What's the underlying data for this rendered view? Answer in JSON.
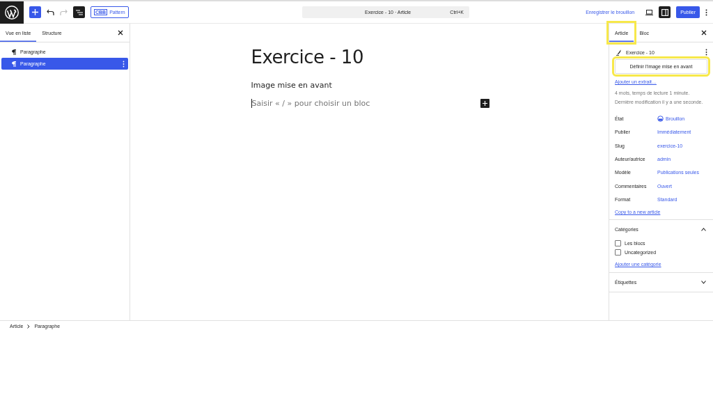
{
  "topbar": {
    "pattern_tag": "CBB",
    "pattern_label": "Pattern",
    "command": "Exercice - 10 · Article",
    "shortcut": "Ctrl+K",
    "save_draft": "Enregistrer le brouillon",
    "settings_open": true,
    "publish": "Publier"
  },
  "list_view": {
    "tabs": [
      {
        "label": "Vue en liste",
        "selected": true
      },
      {
        "label": "Structure",
        "selected": false
      }
    ],
    "items": [
      {
        "label": "Paragraphe",
        "selected": false
      },
      {
        "label": "Paragraphe",
        "selected": true
      }
    ]
  },
  "canvas": {
    "title": "Exercice - 10",
    "paragraph": "Image mise en avant",
    "placeholder": "Saisir « / » pour choisir un bloc"
  },
  "sidebar": {
    "tabs": [
      {
        "label": "Article",
        "selected": true,
        "highlighted": true
      },
      {
        "label": "Bloc",
        "selected": false,
        "highlighted": false
      }
    ],
    "post_title": "Exercice - 10",
    "featured_image_button": {
      "label": "Définir l’image mise en avant",
      "highlighted": true
    },
    "excerpt_link": "Ajouter un extrait…",
    "stats": "4 mots, temps de lecture 1 minute.",
    "last_modified": "Dernière modification il y a une seconde.",
    "fields": [
      {
        "label": "État",
        "value": "Brouillon",
        "kind": "status"
      },
      {
        "label": "Publier",
        "value": "Immédiatement",
        "kind": "link"
      },
      {
        "label": "Slug",
        "value": "exercice-10",
        "kind": "link"
      },
      {
        "label": "Auteur/autrice",
        "value": "admin",
        "kind": "link"
      },
      {
        "label": "Modèle",
        "value": "Publications seules",
        "kind": "link"
      },
      {
        "label": "Commentaires",
        "value": "Ouvert",
        "kind": "link"
      },
      {
        "label": "Format",
        "value": "Standard",
        "kind": "link"
      }
    ],
    "copy_link": "Copy to a new article",
    "panels": [
      {
        "title": "Catégories",
        "expanded": true,
        "options": [
          {
            "label": "Les blocs",
            "checked": false
          },
          {
            "label": "Uncategorized",
            "checked": false
          }
        ],
        "add_link": "Ajouter une catégorie"
      },
      {
        "title": "Étiquettes",
        "expanded": false
      }
    ]
  },
  "breadcrumb": [
    "Article",
    "Paragraphe"
  ]
}
